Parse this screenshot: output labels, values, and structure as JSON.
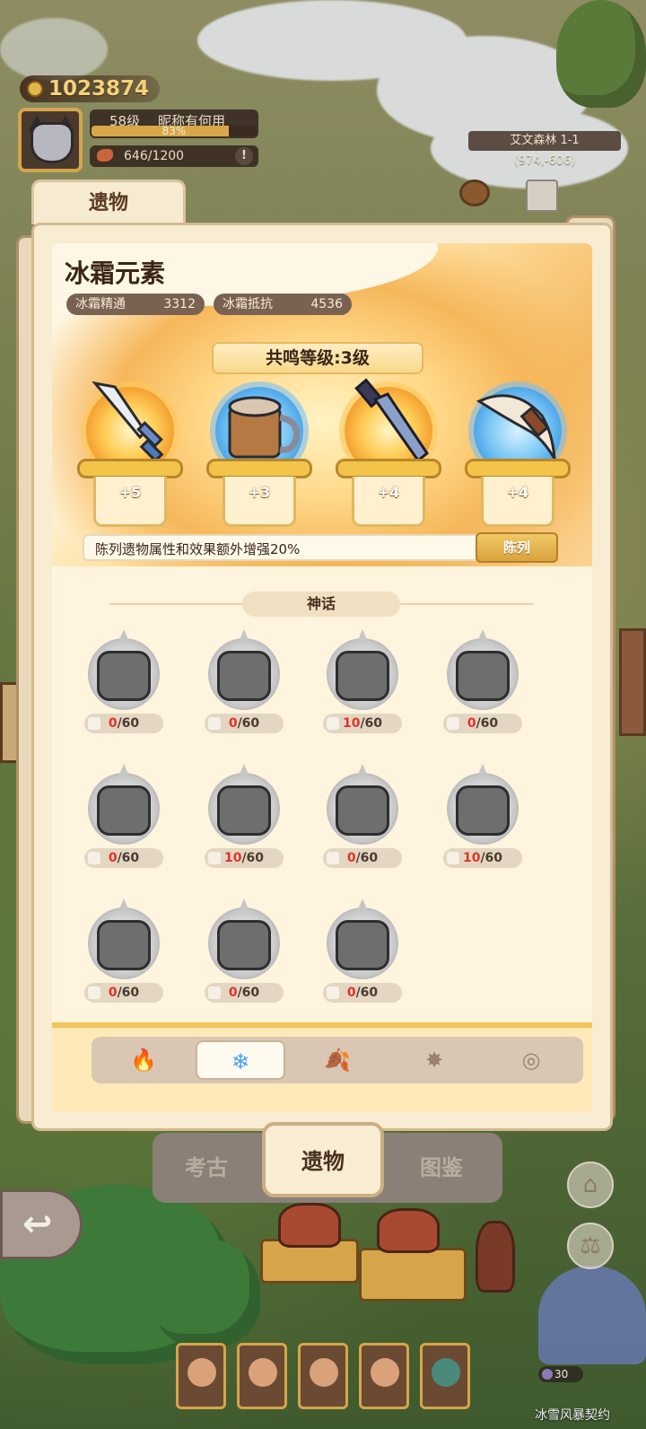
{
  "hud": {
    "gold": "1023874",
    "level": "58级",
    "nickname": "昵称有何用",
    "xp_percent_label": "83%",
    "xp_fraction": 0.83,
    "stamina": "646/1200",
    "alert_icon": "exclamation-icon",
    "location": "艾文森林 1-1",
    "coords": "(974,-606)"
  },
  "panel": {
    "top_tab": "遗物",
    "element_name": "冰霜元素",
    "stats": [
      {
        "label": "冰霜精通",
        "value": "3312"
      },
      {
        "label": "冰霜抵抗",
        "value": "4536"
      }
    ],
    "resonance_label": "共鸣等级:3级",
    "displayed_relics": [
      {
        "name": "sword-relic",
        "level": "+5",
        "orb": "fire"
      },
      {
        "name": "mug-relic",
        "level": "+3",
        "orb": "ice"
      },
      {
        "name": "greatsword-relic",
        "level": "+4",
        "orb": "fire"
      },
      {
        "name": "claw-relic",
        "level": "+4",
        "orb": "ice"
      }
    ],
    "bonus_text": "陈列遗物属性和效果额外增强20%",
    "display_button": "陈列",
    "section_title": "神话",
    "items": [
      {
        "name": "claw-gauntlet",
        "have": "0",
        "need": "/60"
      },
      {
        "name": "battle-axe",
        "have": "0",
        "need": "/60"
      },
      {
        "name": "spiked-pauldron",
        "have": "10",
        "need": "/60"
      },
      {
        "name": "spiked-collar",
        "have": "0",
        "need": "/60"
      },
      {
        "name": "skull-helm",
        "have": "0",
        "need": "/60"
      },
      {
        "name": "crystal-helm",
        "have": "10",
        "need": "/60"
      },
      {
        "name": "bracer",
        "have": "0",
        "need": "/60"
      },
      {
        "name": "swirl-shield",
        "have": "10",
        "need": "/60"
      },
      {
        "name": "flower-brooch",
        "have": "0",
        "need": "/60"
      },
      {
        "name": "mace",
        "have": "0",
        "need": "/60"
      },
      {
        "name": "woven-pouch",
        "have": "0",
        "need": "/60"
      }
    ],
    "element_tabs": [
      {
        "icon": "fire-icon",
        "glyph": "🔥",
        "active": false
      },
      {
        "icon": "snowflake-icon",
        "glyph": "❄",
        "active": true
      },
      {
        "icon": "leaf-icon",
        "glyph": "🍂",
        "active": false
      },
      {
        "icon": "sparkle-icon",
        "glyph": "✸",
        "active": false
      },
      {
        "icon": "swirl-icon",
        "glyph": "◎",
        "active": false
      }
    ]
  },
  "nav": {
    "tabs": [
      "考古",
      "遗物",
      "图鉴"
    ],
    "active": "遗物"
  },
  "bottom": {
    "power": "30",
    "contract_label": "冰雪风暴契约"
  },
  "colors": {
    "accent_gold": "#f2c45a",
    "count_red": "#e0332a",
    "ice_blue": "#47a2f0",
    "panel_bg": "#f8ecd3"
  }
}
